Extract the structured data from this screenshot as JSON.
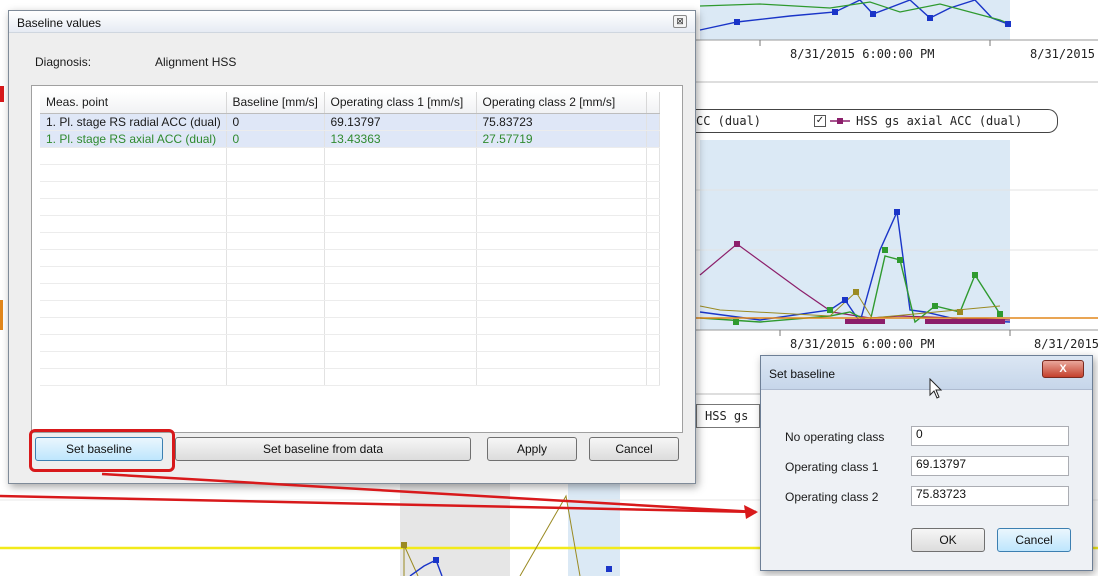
{
  "background_app": {
    "axis_labels": [
      "8/31/2015 6:00:00 PM",
      "8/31/2015"
    ],
    "legend": {
      "partial_item": "CC (dual)",
      "item": "HSS gs axial ACC (dual)",
      "checkbox_mark": "✓"
    },
    "lower_legend_partial": "HSS gs",
    "colors": {
      "blue": "#1a35c8",
      "green": "#2f9a2f",
      "purple": "#8c1f6b",
      "olive": "#9a8a22",
      "yellow": "#f2ea1a",
      "orange": "#e2871b",
      "shade": "#dbe9f5"
    }
  },
  "baseline_dialog": {
    "title": "Baseline values",
    "close_glyph": "⊠",
    "diagnosis_label": "Diagnosis:",
    "diagnosis_value": "Alignment HSS",
    "table": {
      "columns": [
        "Meas. point",
        "Baseline [mm/s]",
        "Operating class 1 [mm/s]",
        "Operating class 2 [mm/s]"
      ],
      "rows": [
        {
          "meas_point": "1. Pl. stage RS radial ACC (dual)",
          "baseline": "0",
          "class1": "69.13797",
          "class2": "75.83723",
          "color": "#1a1a1a"
        },
        {
          "meas_point": "1. Pl. stage RS axial ACC (dual)",
          "baseline": "0",
          "class1": "13.43363",
          "class2": "27.57719",
          "color": "#2f8a2f"
        }
      ]
    },
    "buttons": {
      "set_baseline": "Set baseline",
      "set_baseline_from_data": "Set baseline from data",
      "apply": "Apply",
      "cancel": "Cancel"
    }
  },
  "set_baseline_dialog": {
    "title": "Set baseline",
    "close_glyph": "X",
    "fields": [
      {
        "label": "No operating class",
        "value": "0"
      },
      {
        "label": "Operating class 1",
        "value": "69.13797"
      },
      {
        "label": "Operating class 2",
        "value": "75.83723"
      }
    ],
    "buttons": {
      "ok": "OK",
      "cancel": "Cancel"
    }
  },
  "annotation": {
    "color": "#d8191b"
  }
}
